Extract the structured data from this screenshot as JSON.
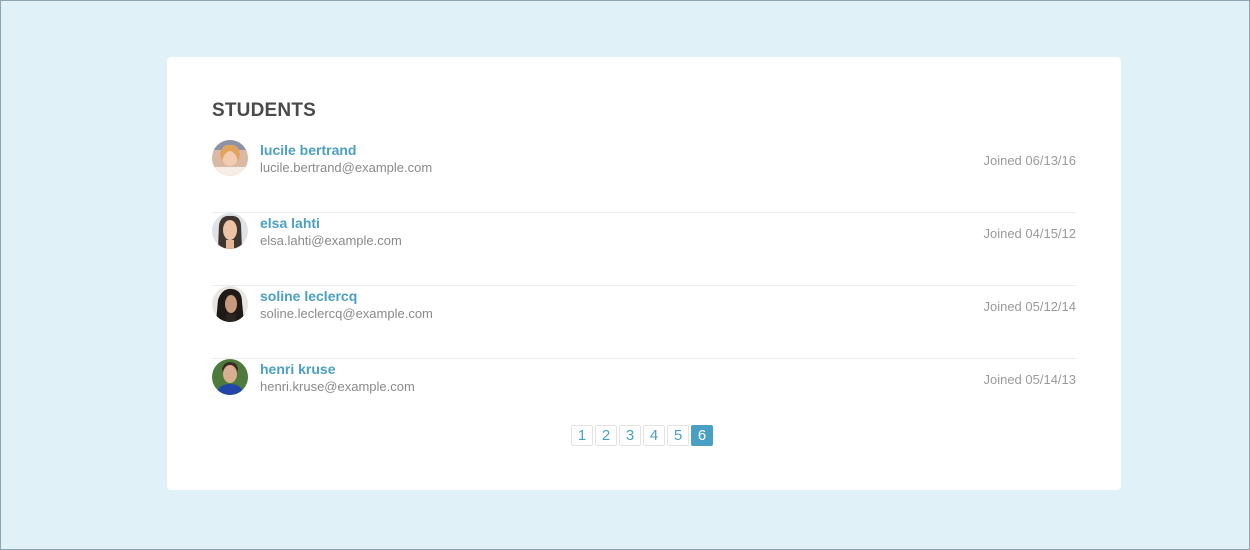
{
  "card": {
    "title": "STUDENTS"
  },
  "students": [
    {
      "name": "lucile bertrand",
      "email": "lucile.bertrand@example.com",
      "joined": "Joined 06/13/16"
    },
    {
      "name": "elsa lahti",
      "email": "elsa.lahti@example.com",
      "joined": "Joined 04/15/12"
    },
    {
      "name": "soline leclercq",
      "email": "soline.leclercq@example.com",
      "joined": "Joined 05/12/14"
    },
    {
      "name": "henri kruse",
      "email": "henri.kruse@example.com",
      "joined": "Joined 05/14/13"
    }
  ],
  "pagination": {
    "pages": [
      "1",
      "2",
      "3",
      "4",
      "5",
      "6"
    ],
    "active": "6"
  },
  "colors": {
    "background": "#e1f1f8",
    "accent": "#4a9fc5",
    "title": "#4a4a4a",
    "muted": "#8a8a8a"
  }
}
